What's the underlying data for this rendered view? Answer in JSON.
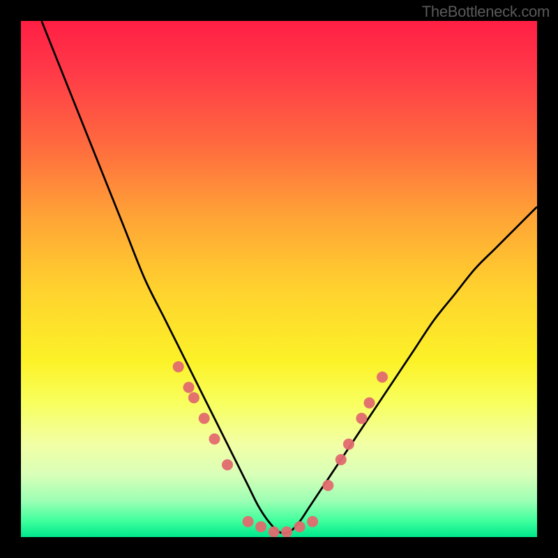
{
  "watermark": "TheBottleneck.com",
  "chart_data": {
    "type": "line",
    "title": "",
    "xlabel": "",
    "ylabel": "",
    "xlim": [
      0,
      100
    ],
    "ylim": [
      0,
      100
    ],
    "series": [
      {
        "name": "bottleneck-curve",
        "x": [
          4,
          8,
          12,
          16,
          20,
          24,
          28,
          32,
          36,
          40,
          42,
          44,
          46,
          48,
          50,
          52,
          54,
          56,
          60,
          64,
          68,
          72,
          76,
          80,
          84,
          88,
          92,
          96,
          100
        ],
        "y": [
          100,
          90,
          80,
          70,
          60,
          50,
          42,
          34,
          26,
          18,
          14,
          10,
          6,
          3,
          1,
          1,
          3,
          6,
          12,
          18,
          24,
          30,
          36,
          42,
          47,
          52,
          56,
          60,
          64
        ],
        "color": "#000000"
      }
    ],
    "markers": [
      {
        "name": "left-marker-1",
        "x": 30.5,
        "y": 33,
        "color": "#e16a6f",
        "size": 10
      },
      {
        "name": "left-marker-2",
        "x": 32.5,
        "y": 29,
        "color": "#e16a6f",
        "size": 10
      },
      {
        "name": "left-marker-3",
        "x": 33.5,
        "y": 27,
        "color": "#e16a6f",
        "size": 10
      },
      {
        "name": "left-marker-4",
        "x": 35.5,
        "y": 23,
        "color": "#e16a6f",
        "size": 10
      },
      {
        "name": "left-marker-5",
        "x": 37.5,
        "y": 19,
        "color": "#e16a6f",
        "size": 10
      },
      {
        "name": "left-marker-6",
        "x": 40.0,
        "y": 14,
        "color": "#e16a6f",
        "size": 10
      },
      {
        "name": "trough-1",
        "x": 44.0,
        "y": 3,
        "color": "#e16a6f",
        "size": 10
      },
      {
        "name": "trough-2",
        "x": 46.5,
        "y": 2,
        "color": "#e16a6f",
        "size": 10
      },
      {
        "name": "trough-3",
        "x": 49.0,
        "y": 1,
        "color": "#e16a6f",
        "size": 10
      },
      {
        "name": "trough-4",
        "x": 51.5,
        "y": 1,
        "color": "#e16a6f",
        "size": 10
      },
      {
        "name": "trough-5",
        "x": 54.0,
        "y": 2,
        "color": "#e16a6f",
        "size": 10
      },
      {
        "name": "trough-6",
        "x": 56.5,
        "y": 3,
        "color": "#e16a6f",
        "size": 10
      },
      {
        "name": "right-marker-1",
        "x": 59.5,
        "y": 10,
        "color": "#e16a6f",
        "size": 10
      },
      {
        "name": "right-marker-2",
        "x": 62.0,
        "y": 15,
        "color": "#e16a6f",
        "size": 10
      },
      {
        "name": "right-marker-3",
        "x": 63.5,
        "y": 18,
        "color": "#e16a6f",
        "size": 10
      },
      {
        "name": "right-marker-4",
        "x": 66.0,
        "y": 23,
        "color": "#e16a6f",
        "size": 10
      },
      {
        "name": "right-marker-5",
        "x": 67.5,
        "y": 26,
        "color": "#e16a6f",
        "size": 10
      },
      {
        "name": "right-marker-6",
        "x": 70.0,
        "y": 31,
        "color": "#e16a6f",
        "size": 10
      }
    ],
    "gradient_stops": [
      {
        "offset": 0,
        "color": "#ff1f44"
      },
      {
        "offset": 25,
        "color": "#ff6e3e"
      },
      {
        "offset": 50,
        "color": "#ffd22e"
      },
      {
        "offset": 75,
        "color": "#f8ff5e"
      },
      {
        "offset": 90,
        "color": "#9cffb4"
      },
      {
        "offset": 100,
        "color": "#00e68c"
      }
    ]
  }
}
